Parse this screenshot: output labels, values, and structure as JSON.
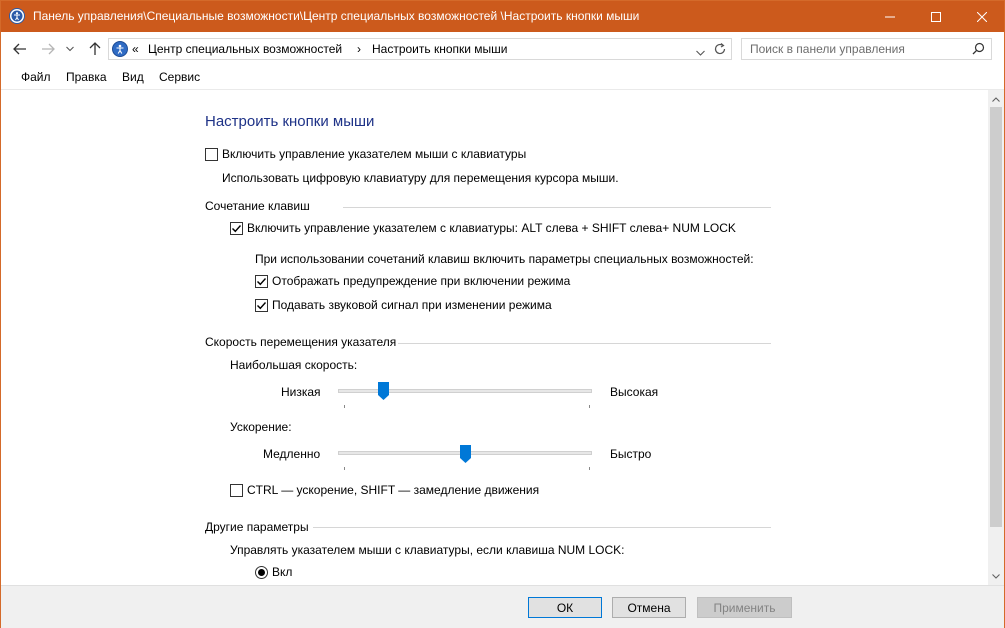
{
  "window": {
    "title": "Панель управления\\Специальные возможности\\Центр специальных возможностей  \\Настроить кнопки мыши",
    "accent_color": "#cc5a1c"
  },
  "address": {
    "overflow": "«",
    "crumb1": "Центр специальных возможностей",
    "separator": "›",
    "crumb2": "Настроить кнопки мыши"
  },
  "search": {
    "placeholder": "Поиск в панели управления"
  },
  "menu": {
    "items": [
      "Файл",
      "Правка",
      "Вид",
      "Сервис"
    ]
  },
  "page": {
    "title": "Настроить кнопки мыши",
    "enable_mouse_keys": {
      "label": "Включить управление указателем мыши с клавиатуры",
      "checked": false
    },
    "enable_description": "Использовать цифровую клавиатуру для перемещения курсора мыши.",
    "shortcut_section": {
      "title": "Сочетание клавиш",
      "shortcut_toggle": {
        "label": "Включить управление указателем с клавиатуры: ALT слева + SHIFT слева+ NUM LOCK",
        "checked": true
      },
      "shortcut_note": "При использовании сочетаний клавиш включить параметры специальных возможностей:",
      "warning_toggle": {
        "label": "Отображать предупреждение при включении режима",
        "checked": true
      },
      "sound_toggle": {
        "label": "Подавать звуковой сигнал при изменении режима",
        "checked": true
      }
    },
    "speed_section": {
      "title": "Скорость перемещения указателя",
      "top_speed_label": "Наибольшая скорость:",
      "top_speed_low": "Низкая",
      "top_speed_high": "Высокая",
      "top_speed_value": 0.18,
      "accel_label": "Ускорение:",
      "accel_low": "Медленно",
      "accel_high": "Быстро",
      "accel_value": 0.5,
      "ctrl_shift_toggle": {
        "label": "CTRL — ускорение, SHIFT — замедление движения",
        "checked": false
      }
    },
    "other_section": {
      "title": "Другие параметры",
      "numlock_label": "Управлять указателем мыши с клавиатуры, если клавиша NUM LOCK:",
      "on_option": {
        "label": "Вкл",
        "selected": true
      }
    }
  },
  "buttons": {
    "ok": "ОК",
    "cancel": "Отмена",
    "apply": "Применить"
  }
}
